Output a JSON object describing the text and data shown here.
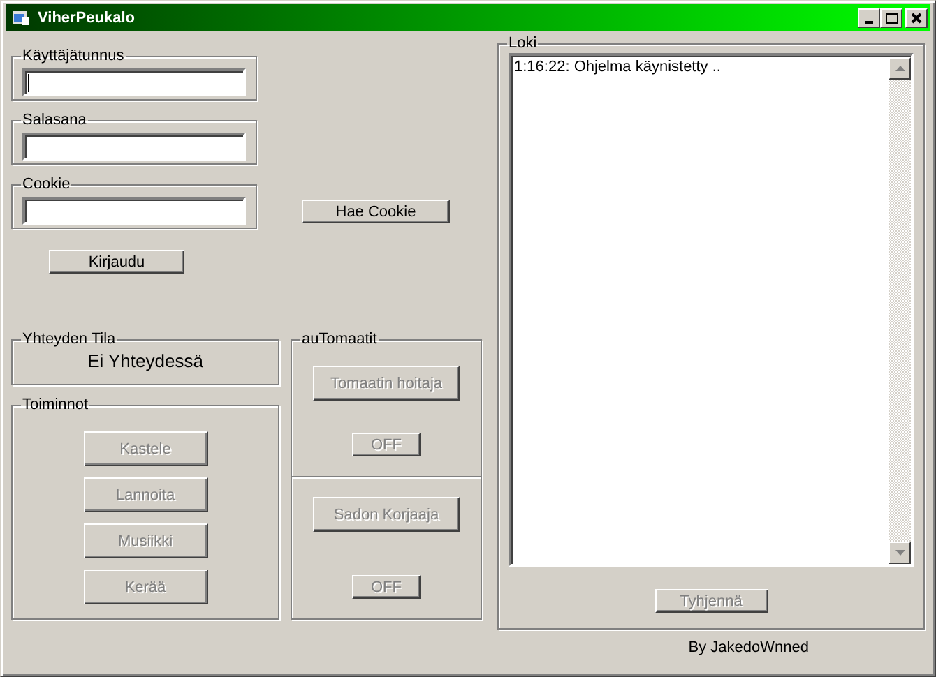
{
  "window": {
    "title": "ViherPeukalo"
  },
  "login": {
    "fields": [
      {
        "label": "Käyttäjätunnus",
        "focused": true
      },
      {
        "label": "Salasana",
        "focused": false
      },
      {
        "label": "Cookie",
        "focused": false
      }
    ],
    "fetch_cookie_button": {
      "label": "Hae Cookie",
      "disabled": false
    },
    "login_button": {
      "label": "Kirjaudu",
      "disabled": false
    }
  },
  "connection": {
    "title": "Yhteyden Tila",
    "status": "Ei Yhteydessä"
  },
  "actions": {
    "title": "Toiminnot",
    "buttons": [
      {
        "label": "Kastele",
        "disabled": true
      },
      {
        "label": "Lannoita",
        "disabled": true
      },
      {
        "label": "Musiikki",
        "disabled": true
      },
      {
        "label": "Kerää",
        "disabled": true
      }
    ]
  },
  "automations": {
    "title": "auTomaatit",
    "sections": [
      {
        "button": {
          "label": "Tomaatin hoitaja",
          "disabled": true
        },
        "toggle": {
          "label": "OFF",
          "disabled": true
        }
      },
      {
        "button": {
          "label": "Sadon Korjaaja",
          "disabled": true
        },
        "toggle": {
          "label": "OFF",
          "disabled": true
        }
      }
    ]
  },
  "log": {
    "title": "Loki",
    "entries": [
      "1:16:22: Ohjelma käynistetty .."
    ],
    "clear_button": {
      "label": "Tyhjennä",
      "disabled": true
    }
  },
  "footer": "By JakedoWnned"
}
